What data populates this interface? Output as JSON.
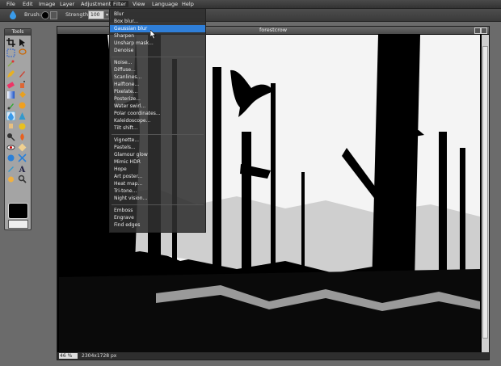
{
  "menubar": {
    "items": [
      "File",
      "Edit",
      "Image",
      "Layer",
      "Adjustment",
      "Filter",
      "View",
      "Language",
      "Help"
    ]
  },
  "options": {
    "brush_label": "Brush:",
    "strength_label": "Strength:",
    "strength_value": "100",
    "strength_arrow": "▾"
  },
  "tools_panel": {
    "title": "Tools"
  },
  "document": {
    "title": "forestcrow",
    "zoom": "46",
    "zoom_unit": "%",
    "dimensions": "2304x1728 px"
  },
  "filter_menu": {
    "groups": [
      [
        "Blur",
        "Box blur...",
        "Gaussian blur",
        "Sharpen",
        "Unsharp mask...",
        "Denoise"
      ],
      [
        "Noise...",
        "Diffuse...",
        "Scanlines...",
        "Halftone...",
        "Pixelate...",
        "Posterize...",
        "Water swirl...",
        "Polar coordinates...",
        "Kaleidoscope...",
        "Tilt shift..."
      ],
      [
        "Vignette...",
        "Pastels...",
        "Glamour glow",
        "Mimic HDR",
        "Hope",
        "Art poster...",
        "Heat map...",
        "Tri-tone...",
        "Night vision..."
      ],
      [
        "Emboss",
        "Engrave",
        "Find edges"
      ]
    ],
    "highlighted": "Gaussian blur"
  },
  "colors": {
    "highlight": "#2f7fd9",
    "panel": "#a4a4a4",
    "workspace": "#6b6b6b"
  }
}
